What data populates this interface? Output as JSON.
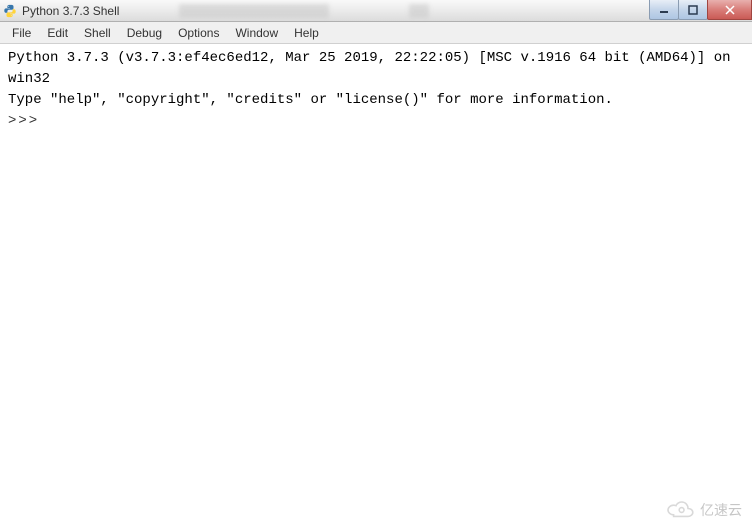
{
  "window": {
    "title": "Python 3.7.3 Shell"
  },
  "menu": {
    "items": [
      {
        "label": "File"
      },
      {
        "label": "Edit"
      },
      {
        "label": "Shell"
      },
      {
        "label": "Debug"
      },
      {
        "label": "Options"
      },
      {
        "label": "Window"
      },
      {
        "label": "Help"
      }
    ]
  },
  "shell": {
    "line1": "Python 3.7.3 (v3.7.3:ef4ec6ed12, Mar 25 2019, 22:22:05) [MSC v.1916 64 bit (AMD64)] on win32",
    "line2": "Type \"help\", \"copyright\", \"credits\" or \"license()\" for more information.",
    "prompt": ">>>"
  },
  "watermark": {
    "text": "亿速云"
  }
}
